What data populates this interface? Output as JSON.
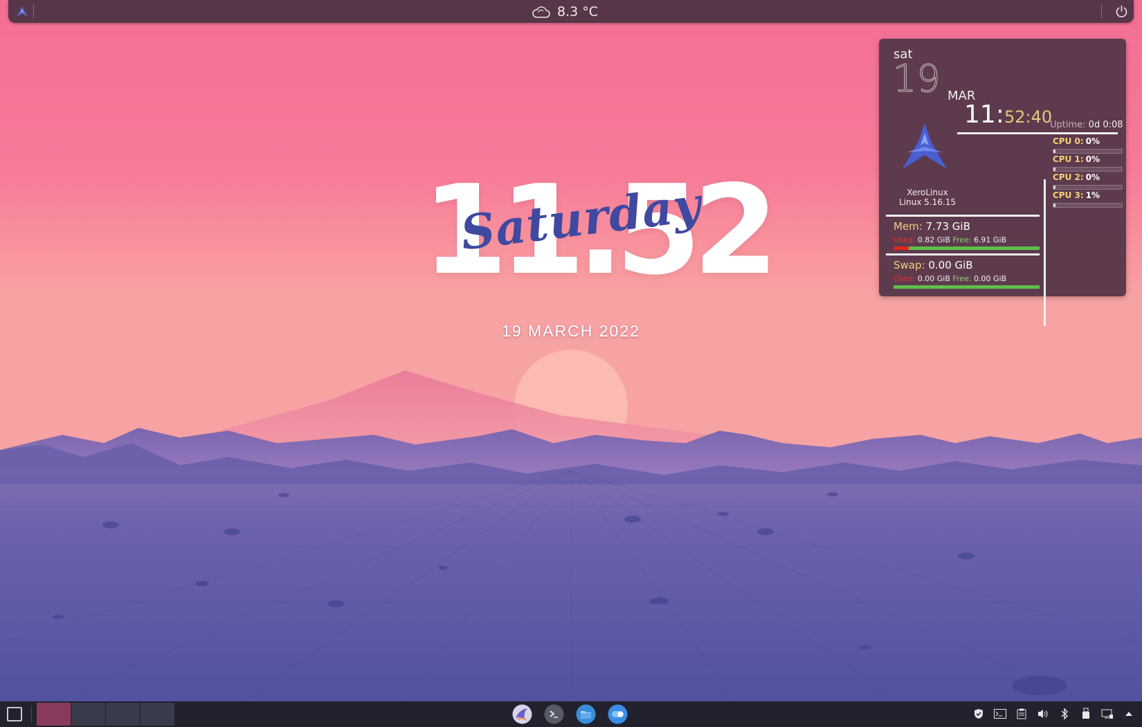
{
  "top_panel": {
    "weather_temp": "8.3 °C",
    "weather_icon": "cloud-icon",
    "launcher_icon": "xerolinux-logo-icon",
    "power_icon": "power-icon"
  },
  "clock": {
    "time": "11.52",
    "day": "Saturday",
    "date": "19 MARCH 2022"
  },
  "conky": {
    "day_short": "sat",
    "day_number": "19",
    "month": "MAR",
    "hours": "11:",
    "min_sec": "52:40",
    "uptime_label": "Uptime:",
    "uptime_value": "0d 0:08",
    "distro": "XeroLinux",
    "kernel": "Linux 5.16.15",
    "cpus": [
      {
        "label": "CPU 0:",
        "value": "0%",
        "percent": 0
      },
      {
        "label": "CPU 1:",
        "value": "0%",
        "percent": 0
      },
      {
        "label": "CPU 2:",
        "value": "0%",
        "percent": 0
      },
      {
        "label": "CPU 3:",
        "value": "1%",
        "percent": 1
      }
    ],
    "mem": {
      "label": "Mem:",
      "total": "7.73 GiB",
      "used_label": "Used:",
      "used": "0.82 GiB",
      "free_label": "Free:",
      "free": "6.91 GiB",
      "used_fraction": 0.106
    },
    "swap": {
      "label": "Swap:",
      "total": "0.00 GiB",
      "used_label": "Used:",
      "used": "0.00 GiB",
      "free_label": "Free:",
      "free": "0.00 GiB",
      "used_fraction": 0
    }
  },
  "bottom_panel": {
    "show_desktop_icon": "show-desktop-icon",
    "pager_count": 4,
    "active_desktop": 1,
    "taskbar_apps": [
      "browser-icon",
      "terminal-icon",
      "file-manager-icon",
      "settings-toggle-icon"
    ],
    "tray_icons": [
      "shield-icon",
      "terminal-tray-icon",
      "clipboard-icon",
      "volume-icon",
      "bluetooth-icon",
      "usb-icon",
      "network-icon",
      "expand-arrow-icon"
    ]
  },
  "colors": {
    "accent": "#f5d07a",
    "panel_bg": "#563648",
    "taskbar_bg": "#21222d",
    "active_desktop": "#8a3b5d",
    "mem_used": "#e0241e",
    "mem_free": "#5ebf4c",
    "clock_day": "#3f49a0"
  }
}
